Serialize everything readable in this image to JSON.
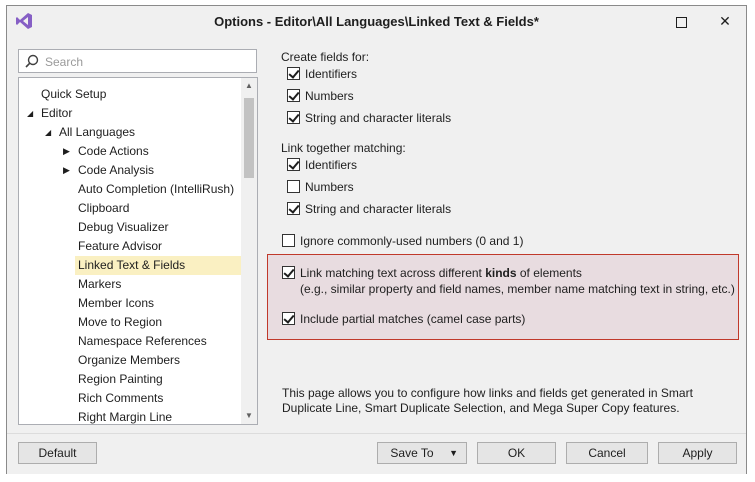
{
  "window": {
    "title": "Options - Editor\\All Languages\\Linked Text & Fields*",
    "maximize_glyph": "",
    "close_glyph": "✕"
  },
  "search": {
    "placeholder": "Search",
    "value": ""
  },
  "tree": {
    "items": [
      {
        "label": "Quick Setup",
        "level": 1,
        "arrow": ""
      },
      {
        "label": "Editor",
        "level": 0,
        "arrow": "◢"
      },
      {
        "label": "All Languages",
        "level": 1,
        "arrow": "◢"
      },
      {
        "label": "Code Actions",
        "level": 2,
        "arrow": "▶"
      },
      {
        "label": "Code Analysis",
        "level": 2,
        "arrow": "▶"
      },
      {
        "label": "Auto Completion (IntelliRush)",
        "level": 3,
        "arrow": ""
      },
      {
        "label": "Clipboard",
        "level": 3,
        "arrow": ""
      },
      {
        "label": "Debug Visualizer",
        "level": 3,
        "arrow": ""
      },
      {
        "label": "Feature Advisor",
        "level": 3,
        "arrow": ""
      },
      {
        "label": "Linked Text & Fields",
        "level": 3,
        "arrow": "",
        "selected": true
      },
      {
        "label": "Markers",
        "level": 3,
        "arrow": ""
      },
      {
        "label": "Member Icons",
        "level": 3,
        "arrow": ""
      },
      {
        "label": "Move to Region",
        "level": 3,
        "arrow": ""
      },
      {
        "label": "Namespace References",
        "level": 3,
        "arrow": ""
      },
      {
        "label": "Organize Members",
        "level": 3,
        "arrow": ""
      },
      {
        "label": "Region Painting",
        "level": 3,
        "arrow": ""
      },
      {
        "label": "Rich Comments",
        "level": 3,
        "arrow": ""
      },
      {
        "label": "Right Margin Line",
        "level": 3,
        "arrow": ""
      }
    ],
    "selected_color": "#faf0c2"
  },
  "create_fields": {
    "label": "Create fields for:",
    "options": [
      {
        "label": "Identifiers",
        "checked": true
      },
      {
        "label": "Numbers",
        "checked": true
      },
      {
        "label": "String and character literals",
        "checked": true
      }
    ]
  },
  "link_together": {
    "label": "Link together matching:",
    "options": [
      {
        "label": "Identifiers",
        "checked": true
      },
      {
        "label": "Numbers",
        "checked": false
      },
      {
        "label": "String and character literals",
        "checked": true
      }
    ]
  },
  "ignore_numbers": {
    "label": "Ignore commonly-used numbers (0 and 1)",
    "checked": false
  },
  "link_across": {
    "label_before": "Link matching text across different ",
    "label_bold": "kinds",
    "label_after": " of elements",
    "label_sub": "(e.g., similar property and field names, member name matching text in string, etc.)",
    "checked": true
  },
  "partial_matches": {
    "label": "Include partial matches (camel case parts)",
    "checked": true
  },
  "description": "This page allows you to configure how links and fields get generated in Smart Duplicate Line, Smart Duplicate Selection, and Mega Super Copy features.",
  "footer": {
    "default_label": "Default",
    "save_to_label": "Save To",
    "ok_label": "OK",
    "cancel_label": "Cancel",
    "apply_label": "Apply"
  },
  "colors": {
    "highlight_border": "#c0392b",
    "highlight_fill": "#e8dce0",
    "vs_purple": "#865fc5"
  }
}
